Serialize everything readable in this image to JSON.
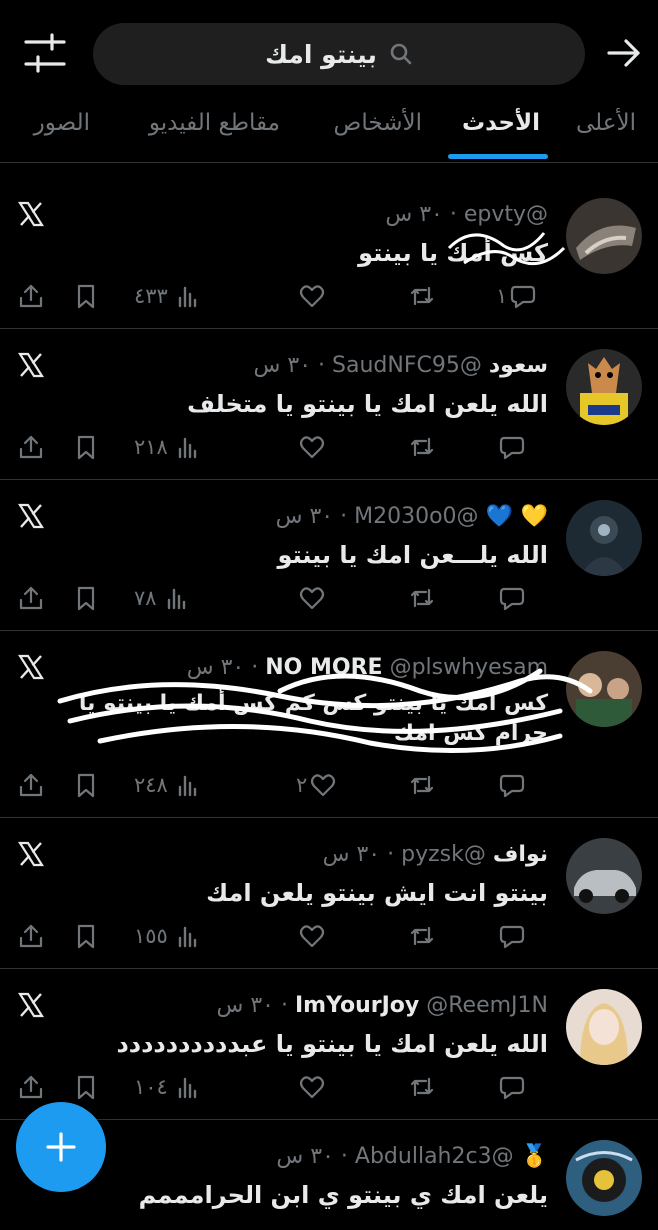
{
  "search": {
    "query": "بينتو امك"
  },
  "tabs": [
    {
      "label": "الأعلى",
      "active": false
    },
    {
      "label": "الأحدث",
      "active": true
    },
    {
      "label": "الأشخاص",
      "active": false
    },
    {
      "label": "مقاطع الفيديو",
      "active": false
    },
    {
      "label": "الصور",
      "active": false
    }
  ],
  "colors": {
    "accent": "#1d9bf0",
    "background": "#000000",
    "muted": "#71767b",
    "divider": "#2f3336"
  },
  "tweets": [
    {
      "name": "",
      "handle": "@epvty",
      "time": "٣٠ س",
      "text": "كس أمك يا بينتو",
      "replies": "١",
      "likes": "",
      "views": "٤٣٣",
      "scribbled": "partial"
    },
    {
      "name": "سعود",
      "handle": "@SaudNFC95",
      "time": "٣٠ س",
      "text": "الله يلعن امك يا بينتو يا متخلف",
      "replies": "",
      "likes": "",
      "views": "٢١٨",
      "scribbled": "none"
    },
    {
      "name": "💛 💙",
      "handle": "@M2030o0",
      "time": "٣٠ س",
      "text": "الله يلـــعن امك يا بينتو",
      "replies": "",
      "likes": "",
      "views": "٧٨",
      "scribbled": "none"
    },
    {
      "name": "NO MORE",
      "handle": "@plswhyesam",
      "time": "٣٠ س",
      "text": "كس أمك يا بينتو كس كم كس أمك يا بينتو يا حرام كس امك",
      "replies": "",
      "likes": "٢",
      "views": "٢٤٨",
      "scribbled": "heavy"
    },
    {
      "name": "نواف",
      "handle": "@pyzsk",
      "time": "٣٠ س",
      "text": "بينتو انت ايش بينتو يلعن امك",
      "replies": "",
      "likes": "",
      "views": "١٥٥",
      "scribbled": "none"
    },
    {
      "name": "ImYourJoy",
      "handle": "@ReemJ1N",
      "time": "٣٠ س",
      "text": "الله يلعن امك يا بينتو يا عبدددددددددد",
      "replies": "",
      "likes": "",
      "views": "١٠٤",
      "scribbled": "none"
    },
    {
      "name": "🥇",
      "handle": "@Abdullah2c3",
      "time": "٣٠ س",
      "text": "يلعن امك ي بينتو ي ابن الحرامممم",
      "replies": "",
      "likes": "",
      "views": "",
      "scribbled": "none"
    }
  ]
}
